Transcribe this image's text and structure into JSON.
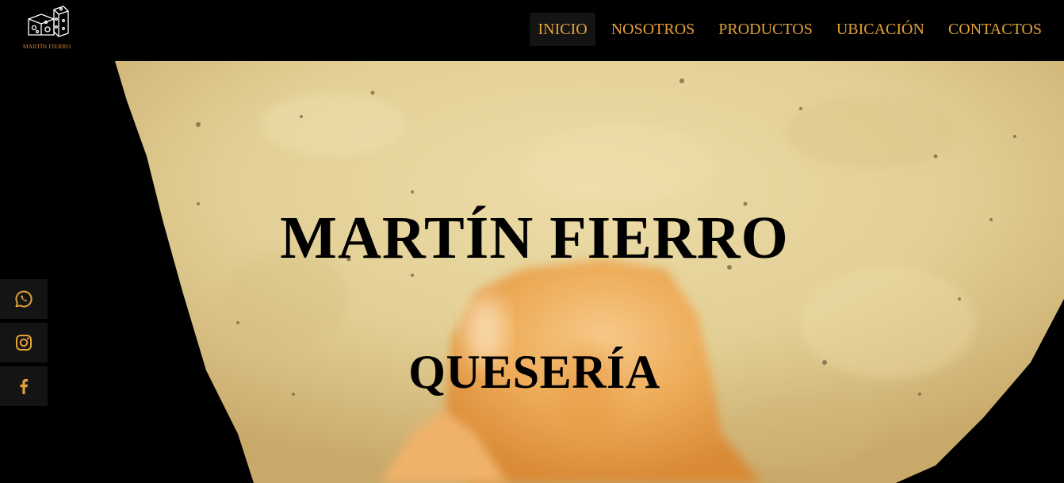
{
  "brand": {
    "logo_text": "MARTÍN FIERRO",
    "logo_icon": "cheese-dice-icon",
    "accent_color": "#e2a13a"
  },
  "nav": {
    "items": [
      {
        "label": "INICIO",
        "active": true
      },
      {
        "label": "NOSOTROS",
        "active": false
      },
      {
        "label": "PRODUCTOS",
        "active": false
      },
      {
        "label": "UBICACIÓN",
        "active": false
      },
      {
        "label": "CONTACTOS",
        "active": false
      }
    ]
  },
  "hero": {
    "title": "MARTÍN FIERRO",
    "subtitle": "QUESERÍA",
    "background": "tortilla-chip-with-melted-cheese-photo"
  },
  "social": [
    {
      "name": "whatsapp",
      "icon": "whatsapp-icon"
    },
    {
      "name": "instagram",
      "icon": "instagram-icon"
    },
    {
      "name": "facebook",
      "icon": "facebook-icon"
    }
  ]
}
